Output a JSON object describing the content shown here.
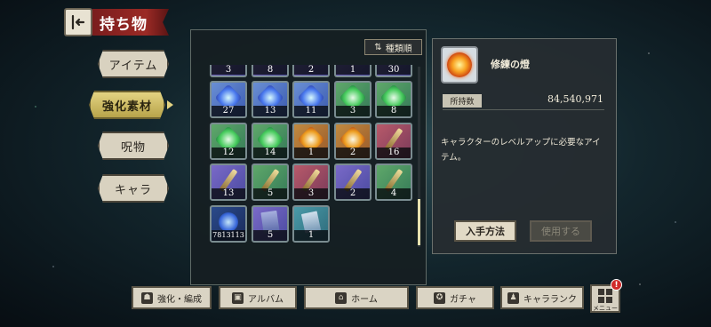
{
  "header": {
    "title": "持ち物"
  },
  "categories": [
    {
      "label": "アイテム",
      "active": false
    },
    {
      "label": "強化素材",
      "active": true
    },
    {
      "label": "呪物",
      "active": false
    },
    {
      "label": "キャラ",
      "active": false
    }
  ],
  "inventory": {
    "sort_label": "種類順",
    "top_row_counts": [
      "3",
      "8",
      "2",
      "1",
      "30"
    ],
    "rows": [
      [
        {
          "count": "27",
          "icon": "blue-crystal-icon",
          "tone": "blue"
        },
        {
          "count": "13",
          "icon": "blue-crystal-icon",
          "tone": "blue"
        },
        {
          "count": "11",
          "icon": "blue-crystal-icon",
          "tone": "blue"
        },
        {
          "count": "3",
          "icon": "green-crystal-icon",
          "tone": "green"
        },
        {
          "count": "8",
          "icon": "green-crystal-icon",
          "tone": "green"
        }
      ],
      [
        {
          "count": "12",
          "icon": "green-crystal-icon",
          "tone": "green"
        },
        {
          "count": "14",
          "icon": "green-crystal-icon",
          "tone": "green"
        },
        {
          "count": "1",
          "icon": "orange-crystal-icon",
          "tone": "orange"
        },
        {
          "count": "2",
          "icon": "orange-crystal-icon",
          "tone": "orange"
        },
        {
          "count": "16",
          "icon": "red-staff-icon",
          "tone": "red"
        }
      ],
      [
        {
          "count": "13",
          "icon": "staff-icon",
          "tone": "purple"
        },
        {
          "count": "5",
          "icon": "staff-icon",
          "tone": "green"
        },
        {
          "count": "3",
          "icon": "red-staff-icon",
          "tone": "red"
        },
        {
          "count": "2",
          "icon": "staff-icon",
          "tone": "purple"
        },
        {
          "count": "4",
          "icon": "staff-icon",
          "tone": "green"
        }
      ],
      [
        {
          "count": "7813113",
          "icon": "blue-orb-icon",
          "tone": "navy"
        },
        {
          "count": "5",
          "icon": "book-icon",
          "tone": "purple"
        },
        {
          "count": "1",
          "icon": "card-icon",
          "tone": "teal"
        }
      ]
    ]
  },
  "detail": {
    "name": "修練の燈",
    "icon": "flame-orb-icon",
    "owned_label": "所持数",
    "owned_value": "84,540,971",
    "description": "キャラクターのレベルアップに必要なアイテム。",
    "acquire_label": "入手方法",
    "use_label": "使用する"
  },
  "bottom_nav": [
    {
      "label": "強化・編成",
      "icon": "team-icon"
    },
    {
      "label": "アルバム",
      "icon": "album-icon"
    },
    {
      "label": "ホーム",
      "icon": "home-icon"
    },
    {
      "label": "ガチャ",
      "icon": "gacha-icon"
    },
    {
      "label": "キャラランク",
      "icon": "rank-icon"
    }
  ],
  "menu": {
    "label": "メニュー",
    "badge": "!"
  }
}
